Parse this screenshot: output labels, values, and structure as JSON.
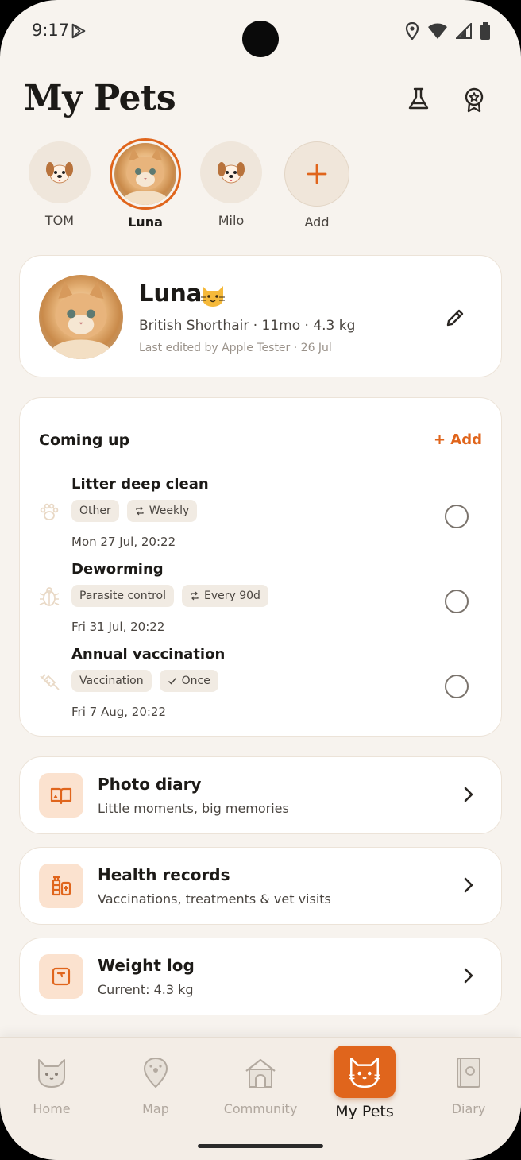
{
  "status_bar": {
    "time": "9:17"
  },
  "header": {
    "title": "My Pets",
    "lab_icon": "flask-icon",
    "award_icon": "award-icon"
  },
  "pets": [
    {
      "name": "TOM",
      "icon": "dog-icon"
    },
    {
      "name": "Luna",
      "icon": "cat-photo",
      "selected": true
    },
    {
      "name": "Milo",
      "icon": "dog-icon"
    },
    {
      "name": "Add",
      "icon": "plus-icon"
    }
  ],
  "profile": {
    "name": "Luna",
    "emoji": "🐱",
    "details": "British Shorthair · 11mo · 4.3 kg",
    "edited": "Last edited by Apple Tester · 26 Jul"
  },
  "coming_up": {
    "title": "Coming up",
    "add_label": "+ Add",
    "tasks": [
      {
        "name": "Litter deep clean",
        "category": "Other",
        "repeat": "Weekly",
        "date": "Mon 27 Jul, 20:22",
        "icon": "paw-icon"
      },
      {
        "name": "Deworming",
        "category": "Parasite control",
        "repeat": "Every 90d",
        "date": "Fri 31 Jul, 20:22",
        "icon": "bug-icon"
      },
      {
        "name": "Annual vaccination",
        "category": "Vaccination",
        "repeat": "Once",
        "date": "Fri 7 Aug, 20:22",
        "icon": "syringe-icon"
      }
    ]
  },
  "links": [
    {
      "title": "Photo diary",
      "subtitle": "Little moments, big memories",
      "icon": "book-icon"
    },
    {
      "title": "Health records",
      "subtitle": "Vaccinations, treatments & vet visits",
      "icon": "medicine-icon"
    },
    {
      "title": "Weight log",
      "subtitle": "Current: 4.3 kg",
      "icon": "scale-icon"
    }
  ],
  "nav": {
    "items": [
      {
        "label": "Home",
        "icon": "cat-face-icon"
      },
      {
        "label": "Map",
        "icon": "map-pin-icon"
      },
      {
        "label": "Community",
        "icon": "house-icon"
      },
      {
        "label": "My Pets",
        "icon": "cat-face-icon",
        "active": true
      },
      {
        "label": "Diary",
        "icon": "diary-icon"
      }
    ]
  },
  "colors": {
    "accent": "#e0651c",
    "background": "#f7f3ee",
    "card": "#ffffff",
    "icon_bg": "#fbe2cf"
  }
}
